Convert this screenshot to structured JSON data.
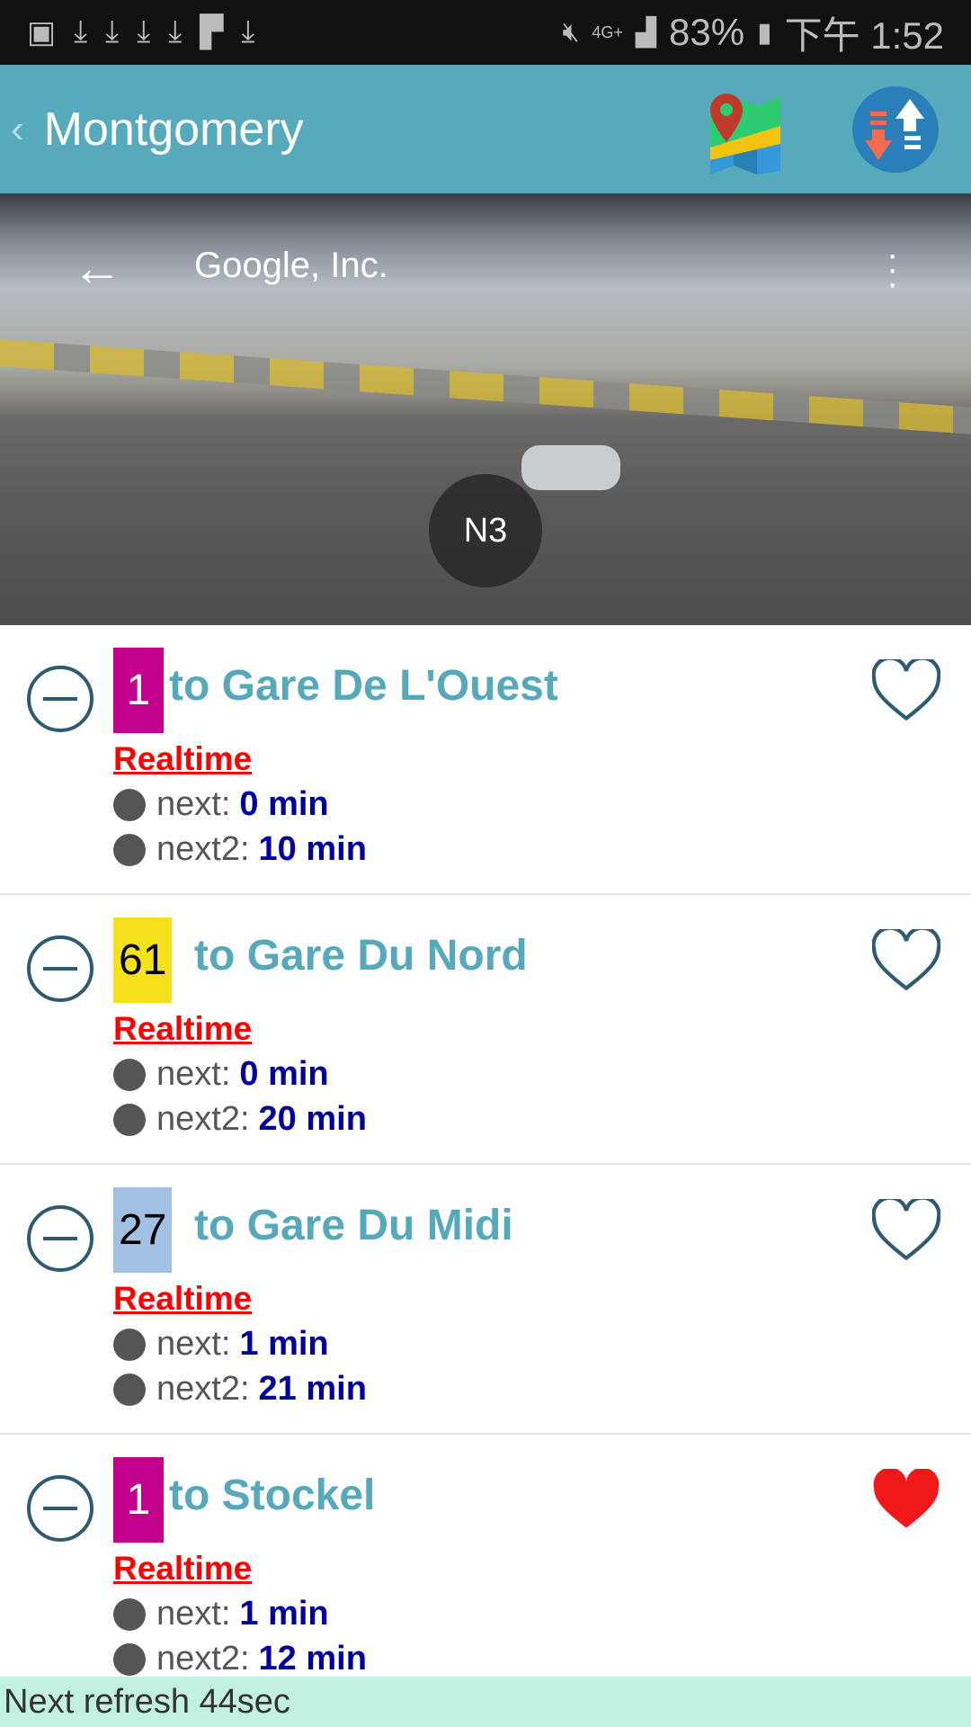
{
  "status_bar": {
    "battery": "83%",
    "time": "下午 1:52",
    "network": "4G+"
  },
  "header": {
    "back": "‹",
    "title": "Montgomery",
    "map_icon": "map-icon",
    "sort_icon": "sort-icon"
  },
  "street_view": {
    "title": "Google, Inc.",
    "road_label": "N3"
  },
  "routes": [
    {
      "line": "1",
      "line_color": "#c2008c",
      "line_text_color": "#ffffff",
      "destination": "to Gare De L'Ouest",
      "realtime": "Realtime",
      "next_label": "next:",
      "next": "0 min",
      "next2_label": "next2:",
      "next2": "10 min",
      "favorite": false
    },
    {
      "line": "61",
      "line_color": "#f5e11a",
      "line_text_color": "#000000",
      "destination": "to Gare Du Nord",
      "realtime": "Realtime",
      "next_label": "next:",
      "next": "0 min",
      "next2_label": "next2:",
      "next2": "20 min",
      "favorite": false
    },
    {
      "line": "27",
      "line_color": "#a1c0e3",
      "line_text_color": "#000000",
      "destination": "to Gare Du Midi",
      "realtime": "Realtime",
      "next_label": "next:",
      "next": "1 min",
      "next2_label": "next2:",
      "next2": "21 min",
      "favorite": false
    },
    {
      "line": "1",
      "line_color": "#c2008c",
      "line_text_color": "#ffffff",
      "destination": "to Stockel",
      "realtime": "Realtime",
      "next_label": "next:",
      "next": "1 min",
      "next2_label": "next2:",
      "next2": "12 min",
      "favorite": true
    }
  ],
  "footer": {
    "refresh": "Next refresh 44sec"
  }
}
